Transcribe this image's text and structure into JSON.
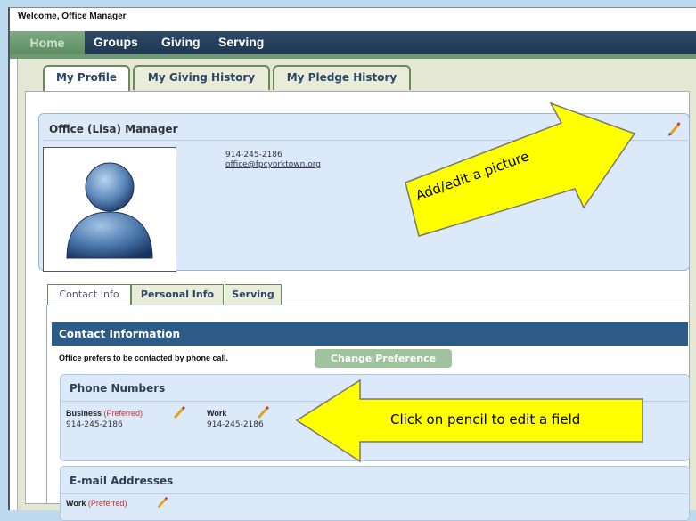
{
  "welcome": "Welcome, Office Manager",
  "nav": [
    "Home",
    "Groups",
    "Giving",
    "Serving"
  ],
  "tabs": [
    "My Profile",
    "My Giving History",
    "My Pledge History"
  ],
  "profile": {
    "name": "Office (Lisa) Manager",
    "phone": "914-245-2186",
    "email": "office@fpcyorktown.org"
  },
  "subtabs": [
    "Contact Info",
    "Personal Info",
    "Serving"
  ],
  "contact": {
    "title": "Contact Information",
    "preference_text": "Office prefers to be contacted by phone call.",
    "change_button": "Change Preference",
    "phone_section": "Phone Numbers",
    "phones": [
      {
        "type": "Business",
        "pref": "(Preferred)",
        "number": "914-245-2186"
      },
      {
        "type": "Work",
        "pref": "",
        "number": "914-245-2186"
      }
    ],
    "email_section": "E-mail Addresses",
    "emails": [
      {
        "type": "Work",
        "pref": "(Preferred)"
      }
    ]
  },
  "callouts": {
    "picture": "Add/edit a picture",
    "pencil": "Click on pencil to edit a field"
  },
  "colors": {
    "nav": "#1f3752",
    "home_tab": "#6e9c72",
    "header_bar": "#2c5b86",
    "callout": "#ffff00",
    "preferred": "#c03030"
  },
  "icons": [
    "pencil-icon",
    "avatar-icon",
    "arrow-right-icon",
    "arrow-left-icon"
  ]
}
